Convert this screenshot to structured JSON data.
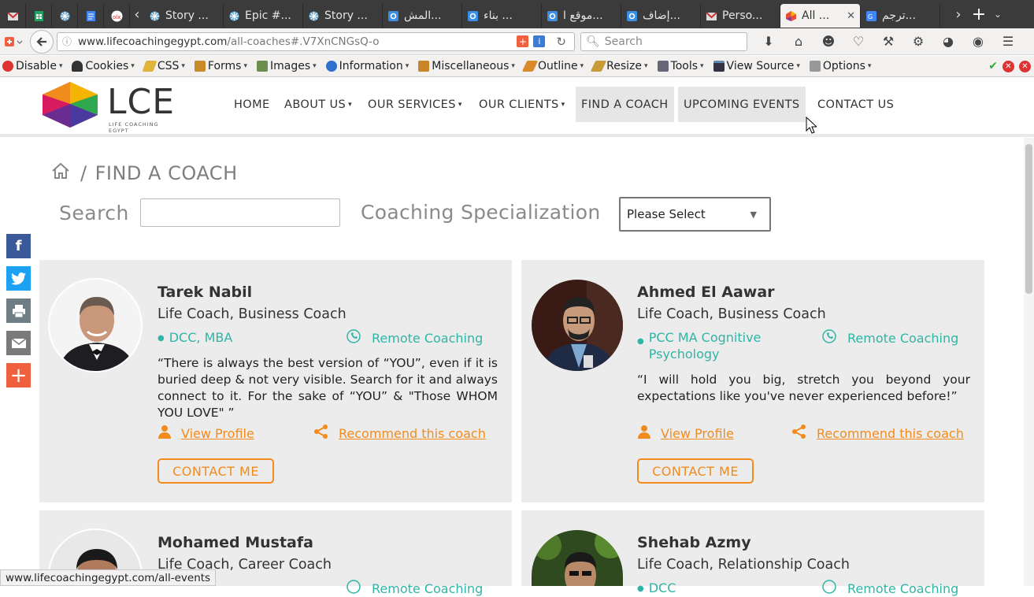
{
  "browser": {
    "tabs": [
      {
        "title": "",
        "icon": "gmail-icon"
      },
      {
        "title": "",
        "icon": "sheets-icon"
      },
      {
        "title": "",
        "icon": "jira-icon"
      },
      {
        "title": "",
        "icon": "docs-icon"
      },
      {
        "title": "",
        "icon": "olx-icon"
      },
      {
        "title": "Story ...",
        "icon": "jira-icon"
      },
      {
        "title": "Epic #...",
        "icon": "jira-icon"
      },
      {
        "title": "Story ...",
        "icon": "jira-icon"
      },
      {
        "title": "المش...",
        "icon": "wix-icon"
      },
      {
        "title": "بناء ...",
        "icon": "wix-icon"
      },
      {
        "title": "موقع ا...",
        "icon": "wix-icon"
      },
      {
        "title": "إضاف...",
        "icon": "wix-icon"
      },
      {
        "title": "Perso...",
        "icon": "gmail-icon"
      },
      {
        "title": "All ...",
        "icon": "lce-icon"
      },
      {
        "title": "ترجم...",
        "icon": "translate-icon"
      }
    ],
    "url_domain": "www.lifecoachingegypt.com",
    "url_path": "/all-coaches#.V7XnCNGsQ-o",
    "search_placeholder": "Search",
    "devbar": [
      "Disable",
      "Cookies",
      "CSS",
      "Forms",
      "Images",
      "Information",
      "Miscellaneous",
      "Outline",
      "Resize",
      "Tools",
      "View Source",
      "Options"
    ],
    "status_text": "www.lifecoachingegypt.com/all-events"
  },
  "site": {
    "logo_text": "LCE",
    "logo_sub": "LIFE COACHING EGYPT",
    "menu": [
      "HOME",
      "ABOUT US",
      "OUR SERVICES",
      "OUR CLIENTS",
      "FIND A COACH",
      "UPCOMING EVENTS",
      "CONTACT US"
    ]
  },
  "page": {
    "breadcrumb_sep": "/",
    "breadcrumb_current": "FIND A COACH",
    "search_label": "Search",
    "search_value": "",
    "spec_label": "Coaching Specialization",
    "spec_selected": "Please Select"
  },
  "coaches": [
    {
      "name": "Tarek Nabil",
      "title": "Life Coach, Business Coach",
      "credentials": "DCC, MBA",
      "remote": "Remote Coaching",
      "quote": "“There is always the best version of “YOU”, even if it is buried deep & not very visible. Search for it and always connect to it. For the sake of “YOU” & \"Those WHOM YOU LOVE\" ”",
      "view_profile": "View Profile",
      "recommend": "Recommend this coach",
      "contact": "CONTACT ME"
    },
    {
      "name": "Ahmed El Aawar",
      "title": "Life Coach, Business Coach",
      "credentials": "PCC MA Cognitive Psychology",
      "remote": "Remote Coaching",
      "quote": "“I will hold you big, stretch you beyond your expectations like you've never experienced before!”",
      "view_profile": "View Profile",
      "recommend": "Recommend this coach",
      "contact": "CONTACT ME"
    },
    {
      "name": "Mohamed Mustafa",
      "title": "Life Coach, Career Coach",
      "credentials": "",
      "remote": "Remote Coaching"
    },
    {
      "name": "Shehab Azmy",
      "title": "Life Coach, Relationship Coach",
      "credentials": "DCC",
      "remote": "Remote Coaching"
    }
  ],
  "colors": {
    "accent_orange": "#f28b1d",
    "accent_teal": "#2fb5a5",
    "card_bg": "#ececec",
    "facebook": "#3b5998",
    "twitter": "#1da1f2",
    "print": "#6f7d85",
    "email": "#7a7a7a",
    "more": "#f0603e"
  }
}
